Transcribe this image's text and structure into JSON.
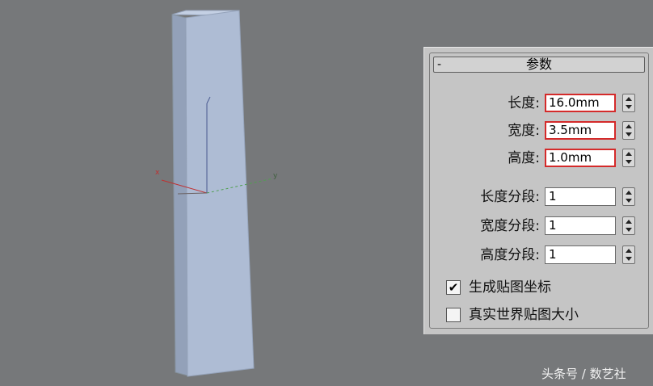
{
  "panel": {
    "collapse_symbol": "-",
    "title": "参数",
    "params": [
      {
        "label": "长度:",
        "value": "16.0mm"
      },
      {
        "label": "宽度:",
        "value": "3.5mm"
      },
      {
        "label": "高度:",
        "value": "1.0mm"
      }
    ],
    "segments": [
      {
        "label": "长度分段:",
        "value": "1"
      },
      {
        "label": "宽度分段:",
        "value": "1"
      },
      {
        "label": "高度分段:",
        "value": "1"
      }
    ],
    "checkboxes": [
      {
        "label": "生成贴图坐标",
        "checked": true,
        "mark": "✔"
      },
      {
        "label": "真实世界贴图大小",
        "checked": false,
        "mark": ""
      }
    ]
  },
  "viewport": {
    "axis_x_label": "x",
    "axis_y_label": "y"
  },
  "watermark": "头条号 / 数艺社",
  "colors": {
    "box_front": "#aebcd4",
    "box_side": "#8f9db5",
    "box_top": "#c4d0e4",
    "highlight_border": "#d42a2a",
    "viewport_bg": "#76787a",
    "panel_bg": "#c5c5c5"
  }
}
